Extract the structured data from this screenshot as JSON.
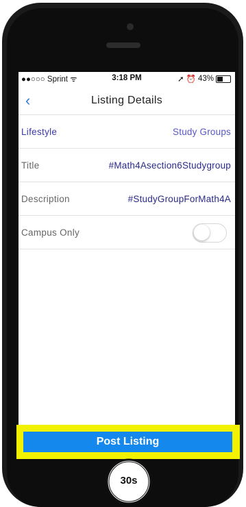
{
  "status_bar": {
    "carrier": "●●○○○ Sprint ᯤ",
    "time": "3:18 PM",
    "battery": "43%",
    "battery_level": 0.43
  },
  "nav": {
    "title": "Listing Details",
    "back_icon": "chevron-left-icon"
  },
  "rows": {
    "lifestyle": {
      "label": "Lifestyle",
      "value": "Study Groups"
    },
    "title": {
      "label": "Title",
      "value": "#Math4Asection6Studygroup"
    },
    "description": {
      "label": "Description",
      "value": "#StudyGroupForMath4A"
    },
    "campus_only": {
      "label": "Campus Only",
      "enabled": false
    }
  },
  "post_button": {
    "label": "Post Listing"
  },
  "timer": {
    "label": "30s"
  },
  "colors": {
    "accent": "#1588ee",
    "highlight": "#f2f200",
    "link": "#2f7bd6",
    "value_text": "#2a2a8a"
  }
}
